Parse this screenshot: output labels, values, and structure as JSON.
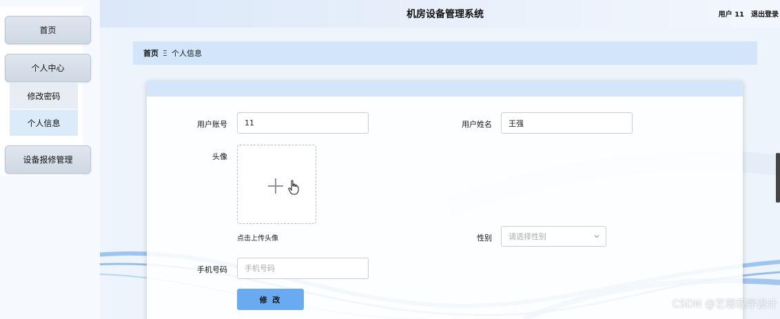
{
  "header": {
    "title": "机房设备管理系统",
    "user": "用户 11",
    "logout": "退出登录"
  },
  "sidebar": {
    "items": [
      {
        "label": "首页"
      },
      {
        "label": "个人中心"
      },
      {
        "label": "修改密码"
      },
      {
        "label": "个人信息"
      },
      {
        "label": "设备报修管理"
      }
    ]
  },
  "breadcrumb": {
    "home": "首页",
    "separator": "Ξ",
    "current": "个人信息"
  },
  "form": {
    "account_label": "用户账号",
    "account_value": "11",
    "name_label": "用户姓名",
    "name_value": "王强",
    "avatar_label": "头像",
    "upload_hint": "点击上传头像",
    "gender_label": "性别",
    "gender_placeholder": "请选择性别",
    "phone_label": "手机号码",
    "phone_placeholder": "手机号码",
    "submit_label": "修 改"
  },
  "watermark": "CSDN @艺馨程序设计",
  "colors": {
    "accent": "#69aaf0",
    "breadcrumb_bg": "#d3e5fb",
    "active_sidebar": "#dcebfa"
  }
}
